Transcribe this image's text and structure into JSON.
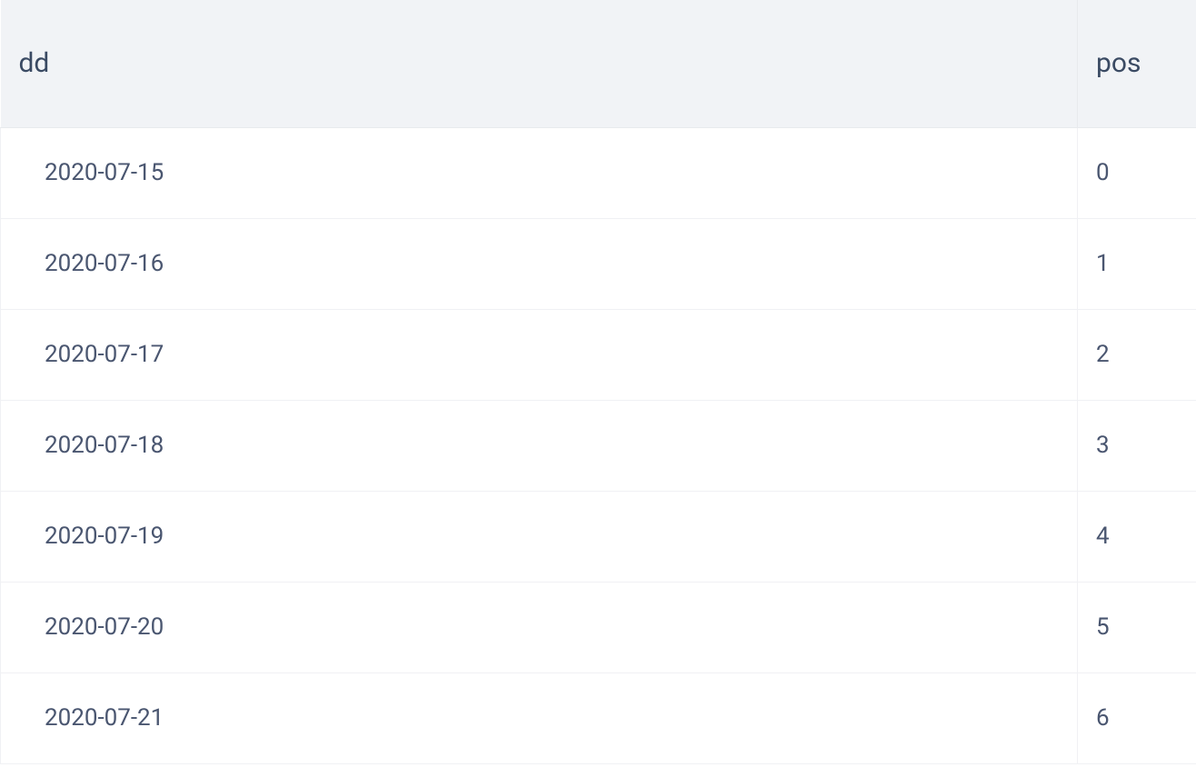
{
  "chart_data": {
    "type": "table",
    "columns": [
      "dd",
      "pos"
    ],
    "rows": [
      {
        "dd": "2020-07-15",
        "pos": 0
      },
      {
        "dd": "2020-07-16",
        "pos": 1
      },
      {
        "dd": "2020-07-17",
        "pos": 2
      },
      {
        "dd": "2020-07-18",
        "pos": 3
      },
      {
        "dd": "2020-07-19",
        "pos": 4
      },
      {
        "dd": "2020-07-20",
        "pos": 5
      },
      {
        "dd": "2020-07-21",
        "pos": 6
      }
    ]
  }
}
